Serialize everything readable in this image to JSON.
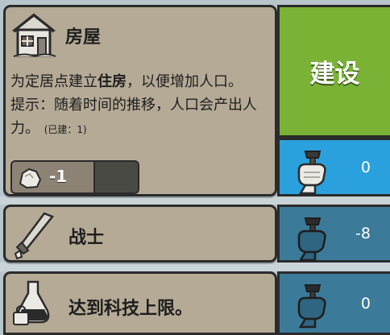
{
  "building_card": {
    "title": "房屋",
    "desc_pre": "为定居点建立",
    "desc_bold": "住房",
    "desc_post": "，以便增加人口。",
    "hint": "提示：随着时间的推移，人口会产出人力。",
    "built_note": "(已建：1)",
    "resource": {
      "icon": "stone-icon",
      "value": "-1",
      "fill_fraction": 0.66
    }
  },
  "build_button": {
    "label": "建设",
    "color": "#7ab236"
  },
  "labor_cost_building": {
    "icon": "worker-fist-hammer-icon",
    "value": "0",
    "color": "#2aa0dc"
  },
  "warrior_card": {
    "icon": "sword-icon",
    "label": "战士",
    "labor_cost": "-8"
  },
  "tech_card": {
    "icon": "locked-flask-icon",
    "label": "达到科技上限。",
    "labor_cost": "0"
  },
  "colors": {
    "card_bg": "#b5aa96",
    "dim_cost_bg": "#3b7a98",
    "outline": "#2b2b2b"
  }
}
